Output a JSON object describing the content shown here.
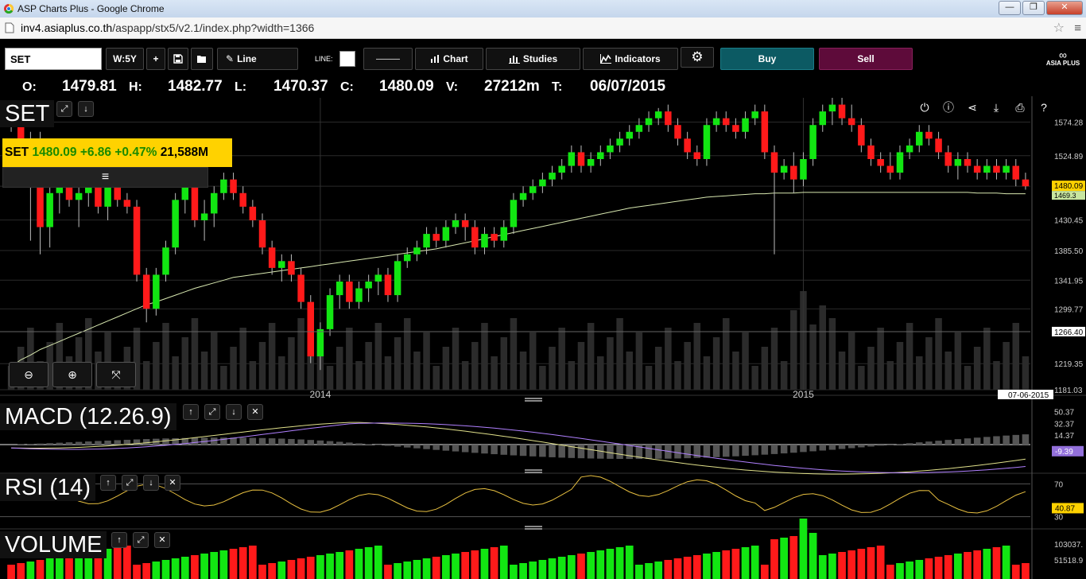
{
  "window": {
    "title": "ASP Charts Plus - Google Chrome",
    "url_host": "inv4.asiaplus.co.th",
    "url_path": "/aspapp/stx5/v2.1/index.php?width=1366"
  },
  "toolbar": {
    "symbol": "SET",
    "period": "W:5Y",
    "plus": "+",
    "line_tool": "Line",
    "line_label": "LINE:",
    "line_style": "———",
    "chart": "Chart",
    "studies": "Studies",
    "indicators": "Indicators",
    "buy": "Buy",
    "sell": "Sell",
    "logo_text": "ASIA PLUS"
  },
  "ohlc": {
    "o_label": "O:",
    "o": "1479.81",
    "h_label": "H:",
    "h": "1482.77",
    "l_label": "L:",
    "l": "1470.37",
    "c_label": "C:",
    "c": "1480.09",
    "v_label": "V:",
    "v": "27212m",
    "t_label": "T:",
    "t": "06/07/2015"
  },
  "quote": {
    "symbol": "SET",
    "price": "1480.09",
    "change": "+6.86",
    "pct": "+0.47%",
    "volume": "21,588M"
  },
  "panels": {
    "main": "SET",
    "macd": "MACD (12.26.9)",
    "rsi": "RSI (14)",
    "volume": "VOLUME"
  },
  "colors": {
    "up": "#12e612",
    "down": "#ff1a1a",
    "ma": "#d8e8b0",
    "macd": "#b080ff",
    "signal": "#e0e08a",
    "rsi": "#e8c040",
    "last_price": "#ffd200"
  },
  "chart_data": [
    {
      "type": "candlestick",
      "title": "SET",
      "x_ticks": [
        "2014",
        "2015"
      ],
      "y_ticks": [
        1574.28,
        1524.89,
        1480.09,
        1430.45,
        1385.5,
        1341.95,
        1299.77,
        1266.4,
        1219.35,
        1181.03
      ],
      "ylim": [
        1181,
        1610
      ],
      "last_label": "1480.09",
      "ma_label": "1469.3",
      "date_label": "07-06-2015",
      "candles": [
        [
          1590,
          1595,
          1560,
          1570
        ],
        [
          1570,
          1575,
          1480,
          1500
        ],
        [
          1500,
          1560,
          1400,
          1550
        ],
        [
          1550,
          1560,
          1380,
          1420
        ],
        [
          1420,
          1480,
          1390,
          1470
        ],
        [
          1470,
          1520,
          1440,
          1500
        ],
        [
          1500,
          1510,
          1450,
          1460
        ],
        [
          1460,
          1480,
          1420,
          1470
        ],
        [
          1470,
          1520,
          1450,
          1490
        ],
        [
          1490,
          1500,
          1440,
          1450
        ],
        [
          1450,
          1490,
          1430,
          1480
        ],
        [
          1480,
          1490,
          1450,
          1460
        ],
        [
          1460,
          1470,
          1440,
          1450
        ],
        [
          1450,
          1460,
          1340,
          1350
        ],
        [
          1350,
          1360,
          1280,
          1300
        ],
        [
          1300,
          1360,
          1290,
          1350
        ],
        [
          1350,
          1400,
          1340,
          1390
        ],
        [
          1390,
          1470,
          1380,
          1460
        ],
        [
          1460,
          1490,
          1440,
          1480
        ],
        [
          1480,
          1500,
          1420,
          1430
        ],
        [
          1430,
          1460,
          1400,
          1440
        ],
        [
          1440,
          1480,
          1420,
          1470
        ],
        [
          1470,
          1500,
          1460,
          1490
        ],
        [
          1490,
          1500,
          1460,
          1470
        ],
        [
          1470,
          1480,
          1440,
          1450
        ],
        [
          1450,
          1460,
          1420,
          1430
        ],
        [
          1430,
          1440,
          1380,
          1390
        ],
        [
          1390,
          1400,
          1350,
          1360
        ],
        [
          1360,
          1380,
          1340,
          1370
        ],
        [
          1370,
          1380,
          1340,
          1350
        ],
        [
          1350,
          1360,
          1300,
          1310
        ],
        [
          1310,
          1320,
          1220,
          1230
        ],
        [
          1230,
          1280,
          1210,
          1270
        ],
        [
          1270,
          1330,
          1260,
          1320
        ],
        [
          1320,
          1350,
          1300,
          1340
        ],
        [
          1340,
          1350,
          1300,
          1310
        ],
        [
          1310,
          1340,
          1300,
          1330
        ],
        [
          1330,
          1350,
          1310,
          1340
        ],
        [
          1340,
          1360,
          1320,
          1350
        ],
        [
          1350,
          1360,
          1310,
          1320
        ],
        [
          1320,
          1380,
          1310,
          1370
        ],
        [
          1370,
          1390,
          1360,
          1380
        ],
        [
          1380,
          1400,
          1370,
          1390
        ],
        [
          1390,
          1420,
          1380,
          1410
        ],
        [
          1410,
          1420,
          1390,
          1400
        ],
        [
          1400,
          1430,
          1390,
          1420
        ],
        [
          1420,
          1440,
          1410,
          1430
        ],
        [
          1430,
          1440,
          1400,
          1420
        ],
        [
          1420,
          1430,
          1380,
          1390
        ],
        [
          1390,
          1420,
          1380,
          1410
        ],
        [
          1410,
          1420,
          1390,
          1400
        ],
        [
          1400,
          1430,
          1390,
          1420
        ],
        [
          1420,
          1470,
          1410,
          1460
        ],
        [
          1460,
          1480,
          1450,
          1470
        ],
        [
          1470,
          1490,
          1460,
          1480
        ],
        [
          1480,
          1500,
          1470,
          1490
        ],
        [
          1490,
          1510,
          1480,
          1500
        ],
        [
          1500,
          1520,
          1490,
          1510
        ],
        [
          1510,
          1540,
          1500,
          1530
        ],
        [
          1530,
          1540,
          1500,
          1510
        ],
        [
          1510,
          1530,
          1500,
          1520
        ],
        [
          1520,
          1540,
          1510,
          1530
        ],
        [
          1530,
          1550,
          1520,
          1540
        ],
        [
          1540,
          1560,
          1530,
          1550
        ],
        [
          1550,
          1570,
          1540,
          1560
        ],
        [
          1560,
          1580,
          1550,
          1570
        ],
        [
          1570,
          1590,
          1560,
          1580
        ],
        [
          1580,
          1595,
          1570,
          1590
        ],
        [
          1590,
          1600,
          1560,
          1570
        ],
        [
          1570,
          1580,
          1540,
          1550
        ],
        [
          1550,
          1560,
          1520,
          1530
        ],
        [
          1530,
          1540,
          1510,
          1520
        ],
        [
          1520,
          1580,
          1510,
          1570
        ],
        [
          1570,
          1590,
          1560,
          1580
        ],
        [
          1580,
          1590,
          1560,
          1570
        ],
        [
          1570,
          1580,
          1550,
          1560
        ],
        [
          1560,
          1590,
          1550,
          1580
        ],
        [
          1580,
          1600,
          1570,
          1590
        ],
        [
          1590,
          1600,
          1520,
          1530
        ],
        [
          1530,
          1540,
          1380,
          1500
        ],
        [
          1500,
          1520,
          1490,
          1510
        ],
        [
          1510,
          1530,
          1470,
          1490
        ],
        [
          1490,
          1530,
          1480,
          1520
        ],
        [
          1520,
          1580,
          1510,
          1570
        ],
        [
          1570,
          1600,
          1560,
          1590
        ],
        [
          1590,
          1610,
          1570,
          1600
        ],
        [
          1600,
          1610,
          1570,
          1580
        ],
        [
          1580,
          1600,
          1560,
          1570
        ],
        [
          1570,
          1580,
          1530,
          1540
        ],
        [
          1540,
          1550,
          1510,
          1520
        ],
        [
          1520,
          1530,
          1500,
          1510
        ],
        [
          1510,
          1530,
          1490,
          1500
        ],
        [
          1500,
          1540,
          1490,
          1530
        ],
        [
          1530,
          1550,
          1520,
          1540
        ],
        [
          1540,
          1570,
          1530,
          1560
        ],
        [
          1560,
          1570,
          1540,
          1550
        ],
        [
          1550,
          1560,
          1520,
          1530
        ],
        [
          1530,
          1540,
          1500,
          1510
        ],
        [
          1510,
          1530,
          1490,
          1520
        ],
        [
          1520,
          1530,
          1500,
          1510
        ],
        [
          1510,
          1520,
          1490,
          1500
        ],
        [
          1500,
          1520,
          1490,
          1510
        ],
        [
          1510,
          1520,
          1490,
          1500
        ],
        [
          1500,
          1520,
          1490,
          1510
        ],
        [
          1510,
          1520,
          1480,
          1490
        ],
        [
          1490,
          1500,
          1475,
          1480
        ]
      ],
      "ma": [
        1215,
        1225,
        1232,
        1240,
        1246,
        1252,
        1258,
        1264,
        1270,
        1276,
        1282,
        1288,
        1294,
        1300,
        1306,
        1310,
        1315,
        1320,
        1325,
        1330,
        1334,
        1338,
        1342,
        1346,
        1348,
        1350,
        1352,
        1354,
        1356,
        1358,
        1360,
        1362,
        1364,
        1366,
        1368,
        1370,
        1372,
        1374,
        1376,
        1378,
        1380,
        1382,
        1384,
        1386,
        1388,
        1391,
        1394,
        1397,
        1400,
        1403,
        1406,
        1409,
        1412,
        1415,
        1418,
        1421,
        1424,
        1427,
        1430,
        1433,
        1436,
        1439,
        1442,
        1445,
        1448,
        1450,
        1452,
        1454,
        1456,
        1458,
        1460,
        1462,
        1464,
        1465,
        1466,
        1467,
        1468,
        1469,
        1469,
        1470,
        1470,
        1470,
        1471,
        1471,
        1471,
        1471,
        1471,
        1471,
        1471,
        1471,
        1471,
        1471,
        1471,
        1471,
        1471,
        1471,
        1471,
        1471,
        1471,
        1471,
        1470,
        1470,
        1470,
        1469,
        1469,
        1469
      ]
    },
    {
      "type": "line",
      "title": "MACD (12.26.9)",
      "y_ticks": [
        50.37,
        32.37,
        14.37
      ],
      "last_label": "-9.39",
      "ylim": [
        -40,
        62
      ]
    },
    {
      "type": "line",
      "title": "RSI (14)",
      "y_ticks": [
        70,
        30
      ],
      "last_label": "40.87",
      "ylim": [
        20,
        80
      ]
    },
    {
      "type": "bar",
      "title": "VOLUME",
      "y_ticks": [
        "103037.",
        "51518.9"
      ]
    }
  ]
}
